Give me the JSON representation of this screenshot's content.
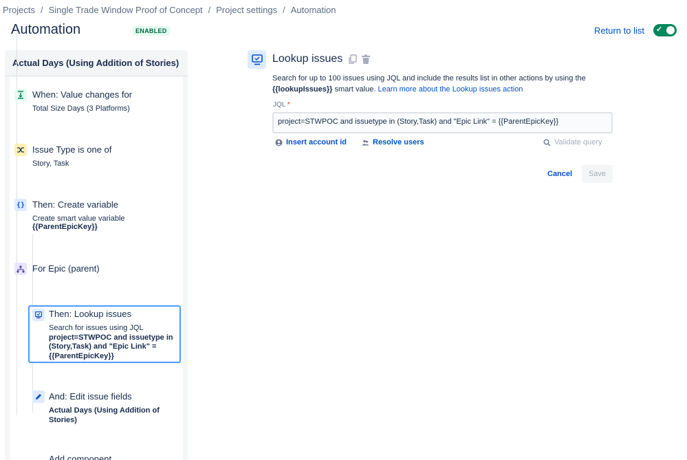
{
  "breadcrumb": {
    "items": [
      "Projects",
      "Single Trade Window Proof of Concept",
      "Project settings",
      "Automation"
    ],
    "separator": "/"
  },
  "header": {
    "title": "Automation",
    "status": "ENABLED",
    "return_link": "Return to list",
    "toggle_checked": true
  },
  "rule": {
    "name": "Actual Days (Using Addition of Stories)",
    "steps": [
      {
        "icon": "value-change-icon",
        "title": "When: Value changes for",
        "sub": "Total Size Days (3 Platforms)"
      },
      {
        "icon": "shuffle-icon",
        "title": "Issue Type is one of",
        "sub": "Story, Task"
      },
      {
        "icon": "braces-icon",
        "title": "Then: Create variable",
        "sub": "Create smart value variable",
        "sub_bold": "{{ParentEpicKey}}"
      },
      {
        "icon": "hierarchy-icon",
        "title": "For Epic (parent)"
      },
      {
        "icon": "lookup-icon",
        "title": "Then: Lookup issues",
        "sub": "Search for issues using JQL",
        "sub_bold": "project=STWPOC and issuetype in (Story,Task) and \"Epic Link\" = {{ParentEpicKey}}"
      },
      {
        "icon": "pencil-icon",
        "title": "And: Edit issue fields",
        "sub_bold": "Actual Days (Using Addition of Stories)"
      }
    ],
    "cut_off_text": "Add component"
  },
  "action": {
    "title": "Lookup issues",
    "desc_1": "Search for up to 100 issues using JQL and include the results list in other actions by using the",
    "desc_bold": "{{lookupIssues}}",
    "desc_2": " smart value. ",
    "desc_link": "Learn more about the Lookup issues action",
    "jql_label": "JQL",
    "jql_required": "*",
    "jql_value": "project=STWPOC and issuetype in (Story,Task) and \"Epic Link\" = {{ParentEpicKey}}",
    "insert_account": "Insert account id",
    "resolve_users": "Resolve users",
    "validate_query": "Validate query",
    "cancel": "Cancel",
    "save": "Save"
  },
  "colors": {
    "link": "#0052cc",
    "toggle": "#00875a",
    "selected_border": "#4c9aff"
  }
}
